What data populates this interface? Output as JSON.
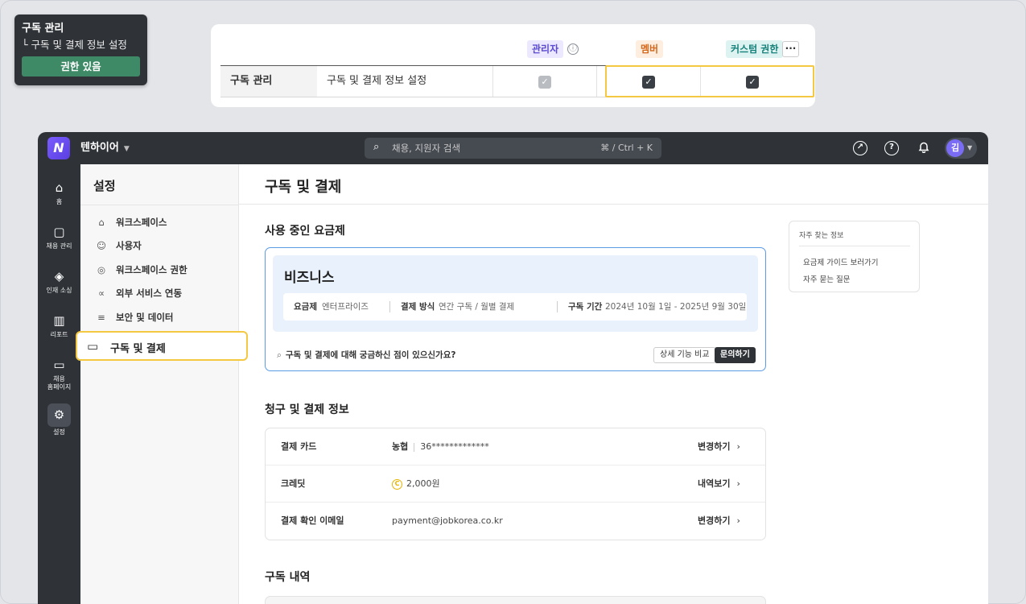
{
  "tooltip": {
    "title": "구독 관리",
    "subtitle": "└ 구독 및 결제 정보 설정",
    "badge": "권한 있음"
  },
  "permission_table": {
    "headers": {
      "admin": "관리자",
      "member": "멤버",
      "custom": "커스텀 권한"
    },
    "info_icon": "ⓘ",
    "more_icon": "···",
    "row": {
      "category": "구독 관리",
      "item": "구독 및 결제 정보 설정",
      "admin_checked": true,
      "member_checked": true,
      "custom_checked": true
    }
  },
  "topbar": {
    "workspace": "텐하이어",
    "search_placeholder": "채용, 지원자 검색",
    "shortcut": "⌘ / Ctrl + K",
    "avatar_initial": "김"
  },
  "rail": {
    "items": [
      {
        "label": "홈",
        "icon": "home-icon"
      },
      {
        "label": "채용 관리",
        "icon": "clipboard-icon"
      },
      {
        "label": "인재 소싱",
        "icon": "layers-icon"
      },
      {
        "label": "리포트",
        "icon": "bar-chart-icon"
      },
      {
        "label": "채용",
        "label2": "홈페이지",
        "icon": "monitor-icon"
      },
      {
        "label": "설정",
        "icon": "gear-icon",
        "active": true
      }
    ]
  },
  "sidebar": {
    "title": "설정",
    "items": [
      {
        "label": "워크스페이스",
        "icon": "building-icon"
      },
      {
        "label": "사용자",
        "icon": "users-icon"
      },
      {
        "label": "워크스페이스 권한",
        "icon": "shield-icon"
      },
      {
        "label": "외부 서비스 연동",
        "icon": "share-icon"
      },
      {
        "label": "보안 및 데이터",
        "icon": "database-icon"
      },
      {
        "label": "구독 및 결제",
        "icon": "credit-card-icon",
        "selected": true
      }
    ]
  },
  "main": {
    "page_title": "구독 및 결제",
    "current_plan_heading": "사용 중인 요금제",
    "plan": {
      "name": "비즈니스",
      "plan_key": "요금제",
      "plan_value": "엔터프라이즈",
      "pay_key": "결제 방식",
      "pay_value": "연간 구독 / 월별 결제",
      "period_key": "구독 기간",
      "period_value": "2024년 10월 1일 - 2025년 9월 30일",
      "question": "구독 및 결제에 대해 궁금하신 점이 있으신가요?",
      "compare_button": "상세 기능 비교",
      "contact_button": "문의하기"
    },
    "billing_heading": "청구 및 결제 정보",
    "billing": [
      {
        "key": "결제 카드",
        "bank": "농협",
        "value": "36*************",
        "action": "변경하기"
      },
      {
        "key": "크레딧",
        "coin": "C",
        "value": "2,000원",
        "action": "내역보기"
      },
      {
        "key": "결제 확인 이메일",
        "value": "payment@jobkorea.co.kr",
        "action": "변경하기"
      }
    ],
    "history_heading": "구독 내역",
    "faq": {
      "title": "자주 찾는 정보",
      "items": [
        "요금제 가이드 보러가기",
        "자주 묻는 질문"
      ]
    }
  },
  "colors": {
    "highlight": "#f5c842",
    "topbar": "#2f3338",
    "brand": "#6a4cf5",
    "plan_border": "#5b9be6",
    "badge_green": "#3e8a66"
  }
}
